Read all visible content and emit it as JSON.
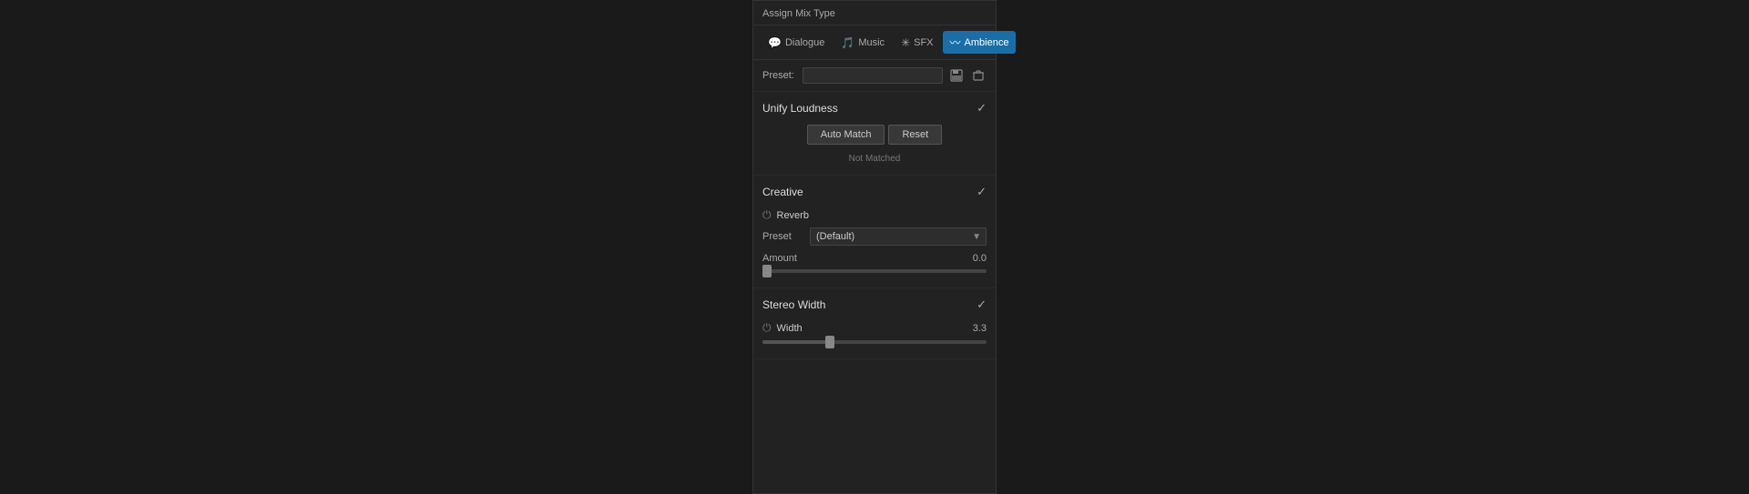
{
  "panel": {
    "title": "Assign Mix Type"
  },
  "tabs": [
    {
      "id": "dialogue",
      "label": "Dialogue",
      "icon": "💬",
      "active": false
    },
    {
      "id": "music",
      "label": "Music",
      "icon": "🎵",
      "active": false
    },
    {
      "id": "sfx",
      "label": "SFX",
      "icon": "✳",
      "active": false
    },
    {
      "id": "ambience",
      "label": "Ambience",
      "icon": "〰",
      "active": true
    }
  ],
  "preset": {
    "label": "Preset:",
    "placeholder": "",
    "save_title": "Save preset",
    "delete_title": "Delete preset"
  },
  "unify_loudness": {
    "title": "Unify Loudness",
    "auto_match_label": "Auto Match",
    "reset_label": "Reset",
    "status": "Not Matched"
  },
  "creative": {
    "title": "Creative",
    "reverb_label": "Reverb",
    "preset_label": "Preset",
    "preset_value": "(Default)",
    "amount_label": "Amount",
    "amount_value": "0.0",
    "slider_fill_pct": 0
  },
  "stereo_width": {
    "title": "Stereo Width",
    "width_label": "Width",
    "width_value": "3.3",
    "slider_fill_pct": 30
  },
  "colors": {
    "active_tab_bg": "#1a6ea8",
    "active_tab_text": "#ffffff",
    "panel_bg": "#222222"
  }
}
